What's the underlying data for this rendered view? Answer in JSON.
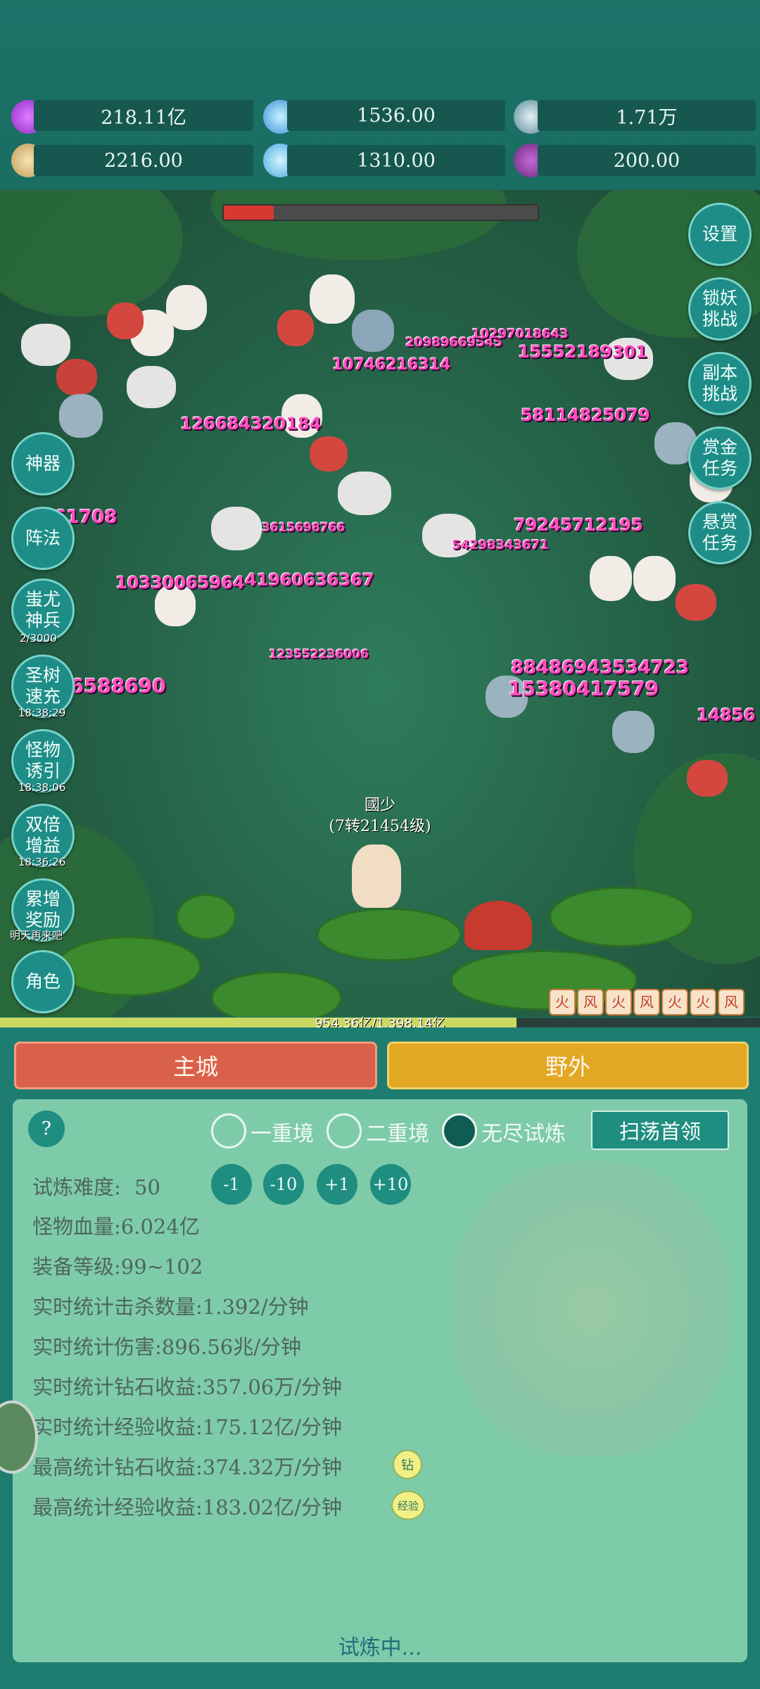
{
  "resources": [
    {
      "icon": "purple-gem-icon",
      "value": "218.11亿"
    },
    {
      "icon": "blue-crystal-icon",
      "value": "1536.00"
    },
    {
      "icon": "orb-icon",
      "value": "1.71万"
    },
    {
      "icon": "scroll-icon",
      "value": "2216.00"
    },
    {
      "icon": "ice-shard-icon",
      "value": "1310.00"
    },
    {
      "icon": "purple-pouch-icon",
      "value": "200.00"
    }
  ],
  "boss_hp_fraction": 0.16,
  "left_buttons": [
    {
      "label": "神器",
      "timer": ""
    },
    {
      "label": "阵法",
      "timer": ""
    },
    {
      "label": "蚩尤神兵",
      "timer": "2/3000"
    },
    {
      "label": "圣树速充",
      "timer": "18:38:29"
    },
    {
      "label": "怪物诱引",
      "timer": "18:38:06"
    },
    {
      "label": "双倍增益",
      "timer": "18:36:26"
    },
    {
      "label": "累增奖励",
      "timer": "明天再来吧"
    },
    {
      "label": "角色",
      "timer": ""
    }
  ],
  "right_buttons": [
    {
      "label": "设置"
    },
    {
      "label": "锁妖挑战"
    },
    {
      "label": "副本挑战"
    },
    {
      "label": "赏金任务"
    },
    {
      "label": "悬赏任务"
    }
  ],
  "damage_numbers": [
    "10746216314",
    "20989669545",
    "10297018643",
    "15552189301",
    "126684320184",
    "58114825079",
    "4961708",
    "3615698766",
    "54298343671",
    "79245712195",
    "10330065964",
    "41960636367",
    "123552236006",
    "46588690",
    "88486943534723",
    "15380417579",
    "14856"
  ],
  "player": {
    "name": "國少",
    "level": "(7转21454级)"
  },
  "xp": {
    "text": "954.36亿/1,398.14亿",
    "fraction": 0.68
  },
  "skill_icons": [
    "火",
    "风",
    "火",
    "风",
    "火",
    "火",
    "风"
  ],
  "tabs": {
    "city": "主城",
    "field": "野外"
  },
  "help": "?",
  "modes": [
    {
      "label": "一重境",
      "selected": false
    },
    {
      "label": "二重境",
      "selected": false
    },
    {
      "label": "无尽试炼",
      "selected": true
    }
  ],
  "sweep_button": "扫荡首领",
  "difficulty": {
    "label": "试炼难度:",
    "value": "50"
  },
  "steps": [
    "-1",
    "-10",
    "+1",
    "+10"
  ],
  "stats": [
    {
      "label": "怪物血量:",
      "value": "6.024亿"
    },
    {
      "label": "装备等级:",
      "value": "99~102"
    },
    {
      "label": "实时统计击杀数量:",
      "value": "1.392/分钟"
    },
    {
      "label": "实时统计伤害:",
      "value": "896.56兆/分钟"
    },
    {
      "label": "实时统计钻石收益:",
      "value": "357.06万/分钟"
    },
    {
      "label": "实时统计经验收益:",
      "value": "175.12亿/分钟"
    },
    {
      "label": "最高统计钻石收益:",
      "value": "374.32万/分钟"
    },
    {
      "label": "最高统计经验收益:",
      "value": "183.02亿/分钟"
    }
  ],
  "badges": {
    "diamond": "钻",
    "exp": "经验"
  },
  "status": "试炼中..."
}
